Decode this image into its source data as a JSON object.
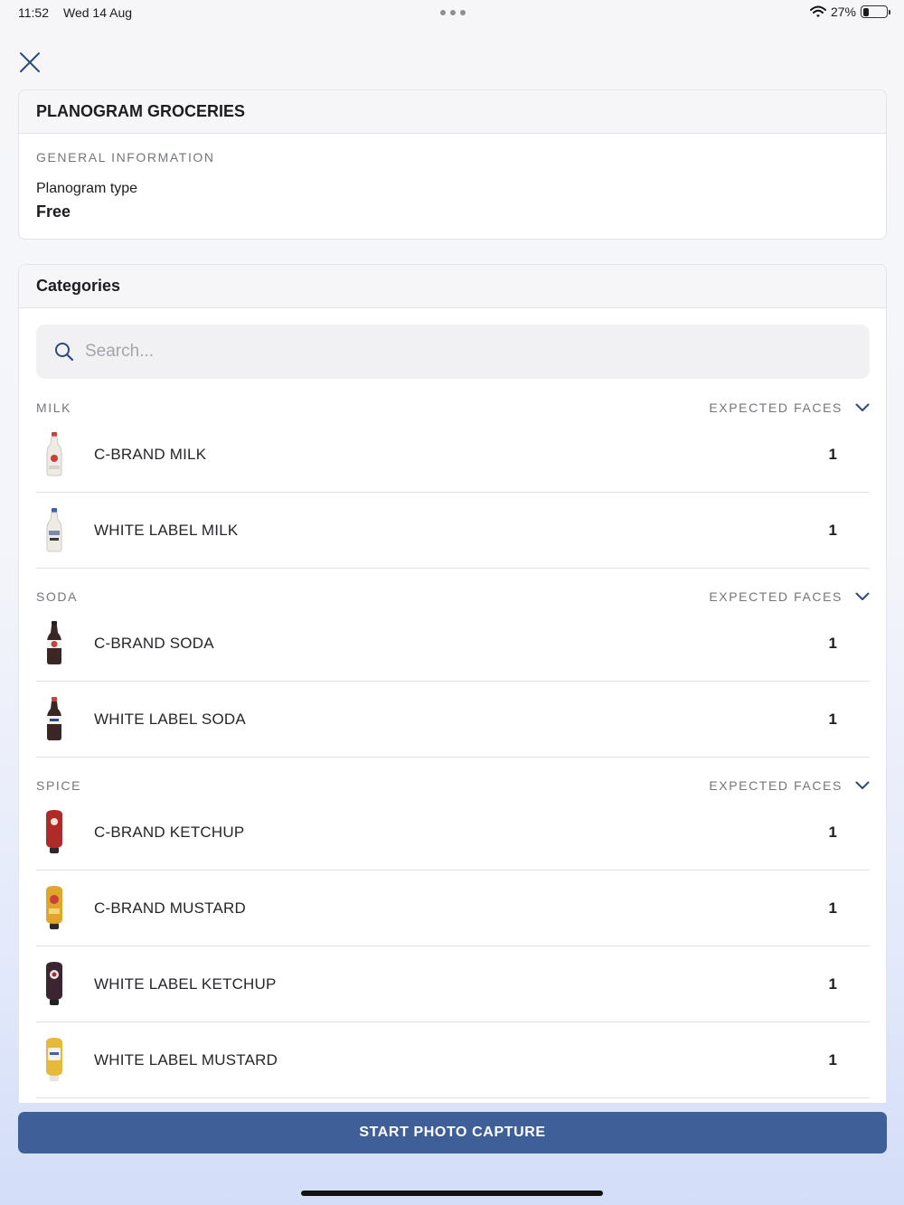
{
  "status_bar": {
    "time": "11:52",
    "date": "Wed 14 Aug",
    "battery": "27%",
    "battery_level": 0.27
  },
  "header": {
    "title": "PLANOGRAM GROCERIES"
  },
  "general": {
    "section_label": "GENERAL INFORMATION",
    "field_label": "Planogram type",
    "field_value": "Free"
  },
  "categories": {
    "title": "Categories",
    "search_placeholder": "Search...",
    "groups": [
      {
        "name": "MILK",
        "column_label": "EXPECTED FACES",
        "items": [
          {
            "name": "C-BRAND MILK",
            "count": "1",
            "icon": "milk-bottle-icon"
          },
          {
            "name": "WHITE LABEL MILK",
            "count": "1",
            "icon": "milk-bottle-icon"
          }
        ]
      },
      {
        "name": "SODA",
        "column_label": "EXPECTED FACES",
        "items": [
          {
            "name": "C-BRAND SODA",
            "count": "1",
            "icon": "soda-bottle-icon"
          },
          {
            "name": "WHITE LABEL SODA",
            "count": "1",
            "icon": "soda-bottle-icon"
          }
        ]
      },
      {
        "name": "SPICE",
        "column_label": "EXPECTED FACES",
        "items": [
          {
            "name": "C-BRAND KETCHUP",
            "count": "1",
            "icon": "ketchup-bottle-icon"
          },
          {
            "name": "C-BRAND MUSTARD",
            "count": "1",
            "icon": "mustard-bottle-icon"
          },
          {
            "name": "WHITE LABEL KETCHUP",
            "count": "1",
            "icon": "ketchup-bottle-icon"
          },
          {
            "name": "WHITE LABEL MUSTARD",
            "count": "1",
            "icon": "mustard-bottle-icon"
          }
        ]
      }
    ]
  },
  "actions": {
    "start_label": "START PHOTO CAPTURE"
  },
  "colors": {
    "primary": "#3f5f98",
    "accent_icon": "#2e4a7d"
  }
}
